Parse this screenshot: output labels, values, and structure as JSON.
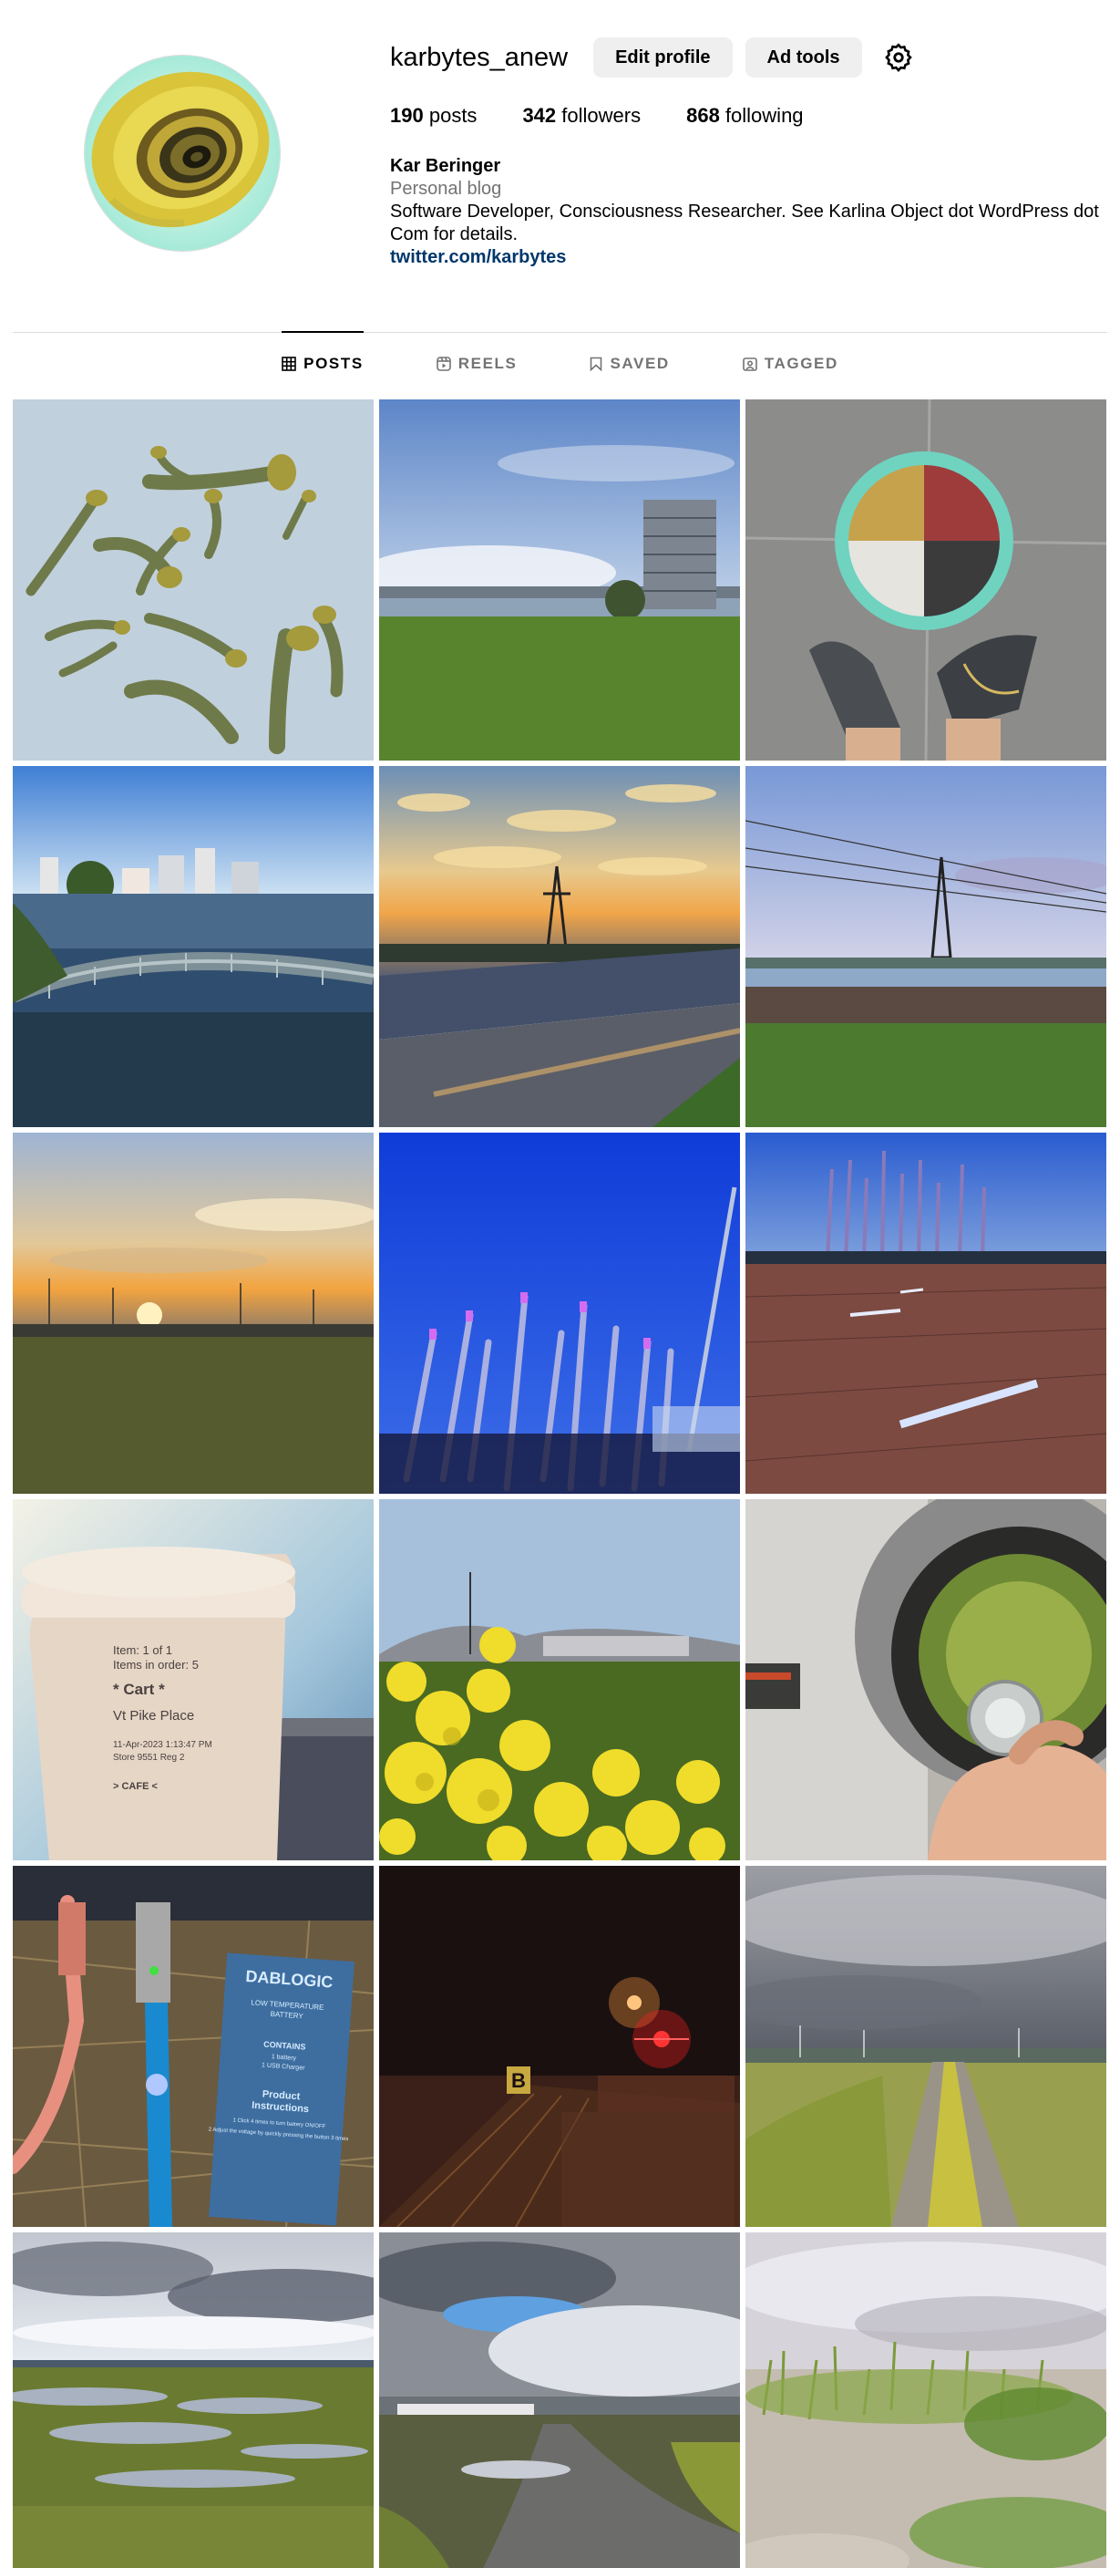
{
  "profile": {
    "username": "karbytes_anew",
    "edit_profile_label": "Edit profile",
    "ad_tools_label": "Ad tools",
    "stats": {
      "posts_count": "190",
      "posts_label": "posts",
      "followers_count": "342",
      "followers_label": "followers",
      "following_count": "868",
      "following_label": "following"
    },
    "bio": {
      "name": "Kar Beringer",
      "category": "Personal blog",
      "text": "Software Developer, Consciousness Researcher. See Karlina Object dot WordPress dot Com for details.",
      "link": "twitter.com/karbytes"
    }
  },
  "tabs": [
    {
      "label": "POSTS",
      "icon": "grid-icon",
      "active": true
    },
    {
      "label": "REELS",
      "icon": "reels-icon",
      "active": false
    },
    {
      "label": "SAVED",
      "icon": "bookmark-icon",
      "active": false
    },
    {
      "label": "TAGGED",
      "icon": "tagged-icon",
      "active": false
    }
  ],
  "posts": [
    {
      "subject": "mushrooms"
    },
    {
      "subject": "lakeside-building"
    },
    {
      "subject": "painted-circle-feet"
    },
    {
      "subject": "lake-bridge"
    },
    {
      "subject": "sunset-canal-pylon"
    },
    {
      "subject": "field-power-lines"
    },
    {
      "subject": "sunset-field"
    },
    {
      "subject": "blue-light-sculpture"
    },
    {
      "subject": "light-poles-plaza"
    },
    {
      "subject": "coffee-cup"
    },
    {
      "subject": "yellow-flowers"
    },
    {
      "subject": "washing-machine"
    },
    {
      "subject": "battery-cables"
    },
    {
      "subject": "night-lights"
    },
    {
      "subject": "cloudy-path"
    },
    {
      "subject": "marsh-clouds"
    },
    {
      "subject": "cloudy-road"
    },
    {
      "subject": "marsh-grass"
    }
  ],
  "post_cup_text": {
    "l1": "Item: 1 of 1",
    "l2": "Items in order: 5",
    "l3": "* Cart *",
    "l4": "Vt Pike Place",
    "l5": "11-Apr-2023 1:13:47 PM",
    "l6": "Store 9551 Reg 2",
    "l7": "> CAFE <"
  },
  "post_battery_text": {
    "brand": "DABLOGIC",
    "l1": "LOW TEMPERATURE",
    "l2": "BATTERY",
    "l3": "CONTAINS",
    "l4": "1 battery",
    "l5": "1 USB Charger",
    "l6": "Product",
    "l7": "Instructions",
    "l8": "1 Click 4 times to turn battery ON/OFF",
    "l9": "2 Adjust the voltage by quickly pressing the button 3 times"
  },
  "post_night_sign": "B",
  "colors": {
    "link": "#00376b",
    "secondary_text": "#737373",
    "button_bg": "#efefef",
    "divider": "#dbdbdb"
  }
}
